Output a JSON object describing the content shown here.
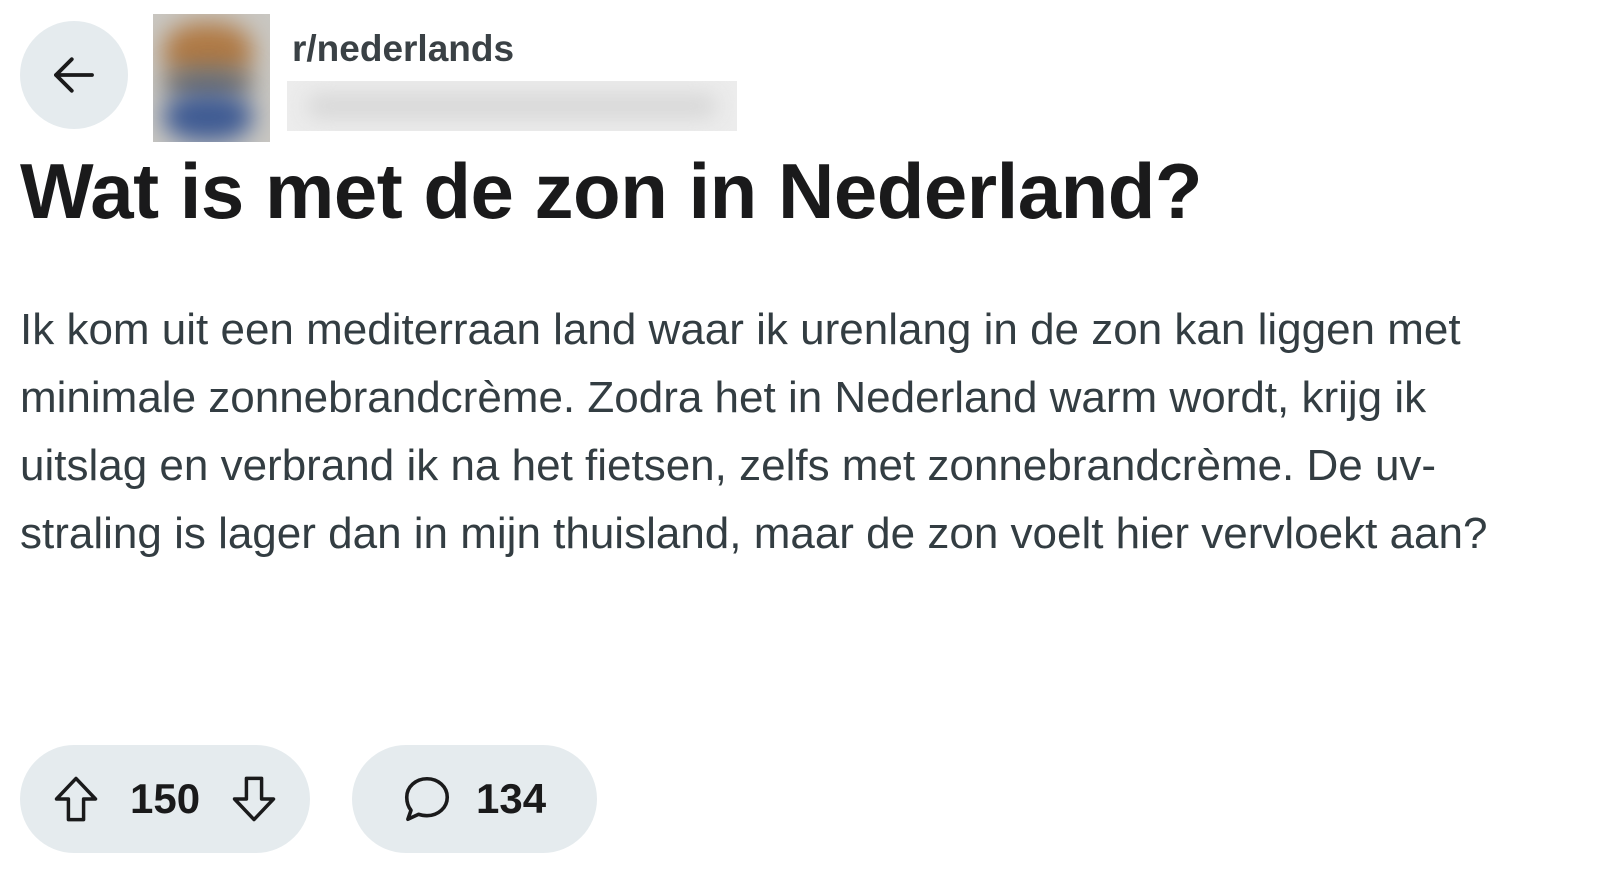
{
  "header": {
    "subreddit": "r/nederlands",
    "back_icon": "arrow-left-icon",
    "avatar_icon": "subreddit-avatar"
  },
  "post": {
    "title": "Wat is met de zon in Nederland?",
    "body": "Ik kom uit een mediterraan land waar ik urenlang in de zon kan liggen met minimale zonnebrandcrème. Zodra het in Nederland warm wordt, krijg ik uitslag en verbrand ik na het fietsen, zelfs met zonnebrandcrème. De uv-straling is lager dan in mijn thuisland, maar de zon voelt hier vervloekt aan?"
  },
  "actions": {
    "vote_count": "150",
    "comment_count": "134",
    "upvote_icon": "arrow-up-icon",
    "downvote_icon": "arrow-down-icon",
    "comment_icon": "speech-bubble-icon"
  },
  "colors": {
    "pill_background": "#e5ebee",
    "text_primary": "#1a1a1b",
    "text_body": "#333d42"
  }
}
